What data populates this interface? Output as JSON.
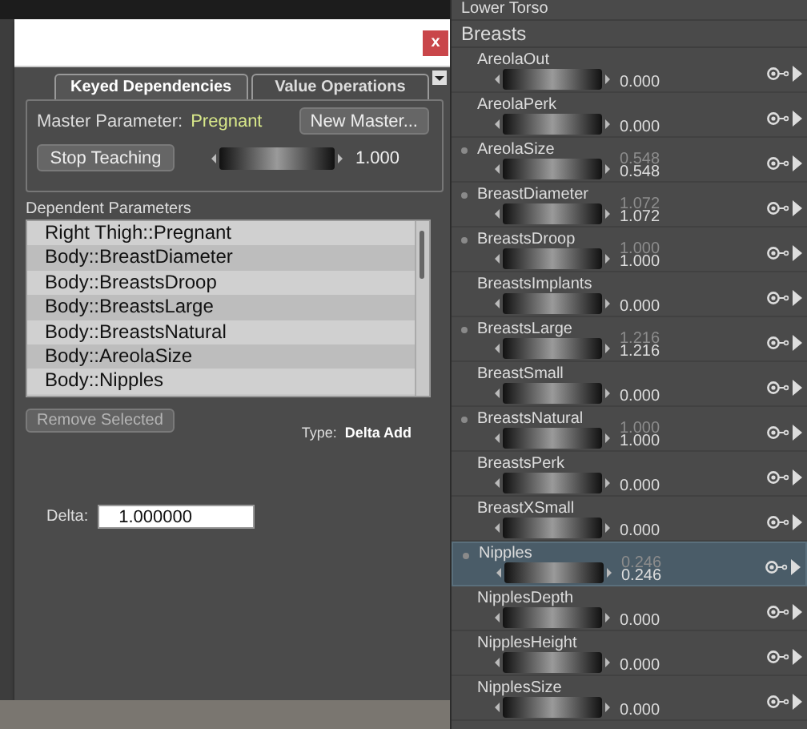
{
  "dialog": {
    "close_label": "x",
    "tabs": [
      {
        "label": "Keyed Dependencies",
        "selected": true
      },
      {
        "label": "Value Operations",
        "selected": false
      }
    ],
    "master_label": "Master Parameter:",
    "master_value": "Pregnant",
    "new_master_button": "New Master...",
    "stop_teaching_button": "Stop Teaching",
    "dial_value": "1.000",
    "dependents_label": "Dependent Parameters",
    "dependents": [
      {
        "label": "Right Thigh::Pregnant",
        "selected": false
      },
      {
        "label": "Body::BreastDiameter",
        "selected": false
      },
      {
        "label": "Body::BreastsDroop",
        "selected": false
      },
      {
        "label": "Body::BreastsLarge",
        "selected": false
      },
      {
        "label": "Body::BreastsNatural",
        "selected": false
      },
      {
        "label": "Body::AreolaSize",
        "selected": false
      },
      {
        "label": "Body::Nipples",
        "selected": false
      }
    ],
    "remove_button": {
      "label": "Remove Selected",
      "disabled": true
    },
    "type_label": "Type:",
    "type_value": "Delta Add",
    "delta_label": "Delta:",
    "delta_value": "1.000000"
  },
  "parameters": {
    "groups": [
      {
        "label": "Lower Torso"
      },
      {
        "label": "Breasts"
      }
    ],
    "rows": [
      {
        "name": "AreolaOut",
        "values": [
          "0.000"
        ],
        "modified": false,
        "selected": false
      },
      {
        "name": "AreolaPerk",
        "values": [
          "0.000"
        ],
        "modified": false,
        "selected": false
      },
      {
        "name": "AreolaSize",
        "values": [
          "0.548",
          "0.548"
        ],
        "modified": true,
        "selected": false
      },
      {
        "name": "BreastDiameter",
        "values": [
          "1.072",
          "1.072"
        ],
        "modified": true,
        "selected": false
      },
      {
        "name": "BreastsDroop",
        "values": [
          "1.000",
          "1.000"
        ],
        "modified": true,
        "selected": false
      },
      {
        "name": "BreastsImplants",
        "values": [
          "0.000"
        ],
        "modified": false,
        "selected": false
      },
      {
        "name": "BreastsLarge",
        "values": [
          "1.216",
          "1.216"
        ],
        "modified": true,
        "selected": false
      },
      {
        "name": "BreastSmall",
        "values": [
          "0.000"
        ],
        "modified": false,
        "selected": false
      },
      {
        "name": "BreastsNatural",
        "values": [
          "1.000",
          "1.000"
        ],
        "modified": true,
        "selected": false
      },
      {
        "name": "BreastsPerk",
        "values": [
          "0.000"
        ],
        "modified": false,
        "selected": false
      },
      {
        "name": "BreastXSmall",
        "values": [
          "0.000"
        ],
        "modified": false,
        "selected": false
      },
      {
        "name": "Nipples",
        "values": [
          "0.246",
          "0.246"
        ],
        "modified": true,
        "selected": true
      },
      {
        "name": "NipplesDepth",
        "values": [
          "0.000"
        ],
        "modified": false,
        "selected": false
      },
      {
        "name": "NipplesHeight",
        "values": [
          "0.000"
        ],
        "modified": false,
        "selected": false
      },
      {
        "name": "NipplesSize",
        "values": [
          "0.000"
        ],
        "modified": false,
        "selected": false
      }
    ]
  }
}
